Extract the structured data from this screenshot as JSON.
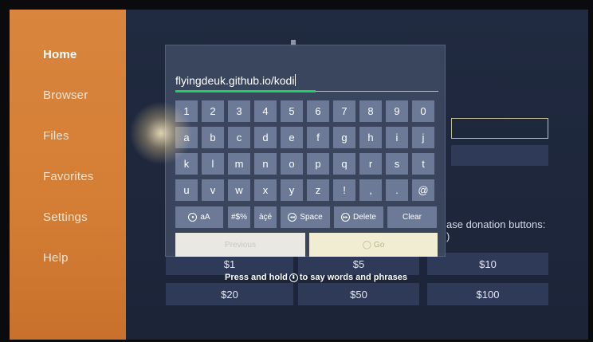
{
  "sidebar": {
    "items": [
      {
        "label": "Home",
        "active": true
      },
      {
        "label": "Browser"
      },
      {
        "label": "Files"
      },
      {
        "label": "Favorites"
      },
      {
        "label": "Settings"
      },
      {
        "label": "Help"
      }
    ]
  },
  "background": {
    "donation_text_line1": "ase donation buttons:",
    "donation_text_line2": ")",
    "amounts_row1": [
      "$1",
      "$5",
      "$10"
    ],
    "amounts_row2": [
      "$20",
      "$50",
      "$100"
    ]
  },
  "keyboard": {
    "input_value": "flyingdeuk.github.io/kodi",
    "rows": [
      [
        "1",
        "2",
        "3",
        "4",
        "5",
        "6",
        "7",
        "8",
        "9",
        "0"
      ],
      [
        "a",
        "b",
        "c",
        "d",
        "e",
        "f",
        "g",
        "h",
        "i",
        "j"
      ],
      [
        "k",
        "l",
        "m",
        "n",
        "o",
        "p",
        "q",
        "r",
        "s",
        "t"
      ],
      [
        "u",
        "v",
        "w",
        "x",
        "y",
        "z",
        "!",
        ",",
        ".",
        "@"
      ]
    ],
    "function_keys": {
      "caps": "aA",
      "symbols": "#$%",
      "accents": "àçé",
      "space": "Space",
      "delete": "Delete",
      "clear": "Clear"
    },
    "cancel_label": "Previous",
    "go_label": "Go",
    "hint_prefix": "Press and hold",
    "hint_suffix": "to say words and phrases"
  },
  "colors": {
    "sidebar": "#d47d35",
    "background": "#1d2436",
    "keyboard_panel": "#3c4860",
    "key": "#6c7a98",
    "input_highlight": "#1fd15a",
    "go_button": "#f1edd3"
  }
}
